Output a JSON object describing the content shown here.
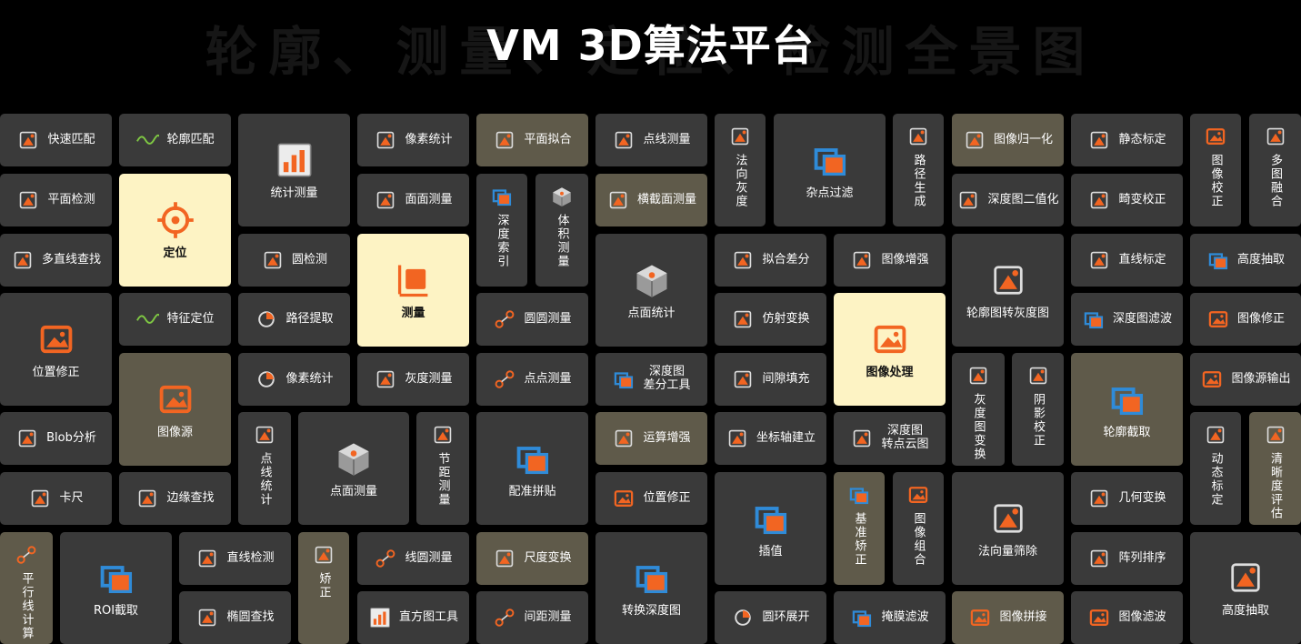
{
  "title": "VM 3D算法平台",
  "ghost_title": "轮廓、测量、定位、检测全景图",
  "colors": {
    "accent": "#f26522",
    "blue": "#2f8bd8",
    "tile": "#3a3a3a",
    "olive": "#5f5a4a",
    "highlight": "#fdf3c4"
  },
  "tiles": [
    {
      "label": "快速匹配",
      "icon": "cone-match-icon"
    },
    {
      "label": "轮廓匹配",
      "icon": "wave-icon"
    },
    {
      "label": "统计测量",
      "icon": "bar-chart-icon"
    },
    {
      "label": "像素统计",
      "icon": "pixel-grid-icon"
    },
    {
      "label": "平面拟合",
      "icon": "plane-fit-icon"
    },
    {
      "label": "点线测量",
      "icon": "point-line-icon"
    },
    {
      "label": "法向灰度",
      "icon": "normal-gray-icon"
    },
    {
      "label": "杂点过滤",
      "icon": "noise-filter-icon"
    },
    {
      "label": "路径生成",
      "icon": "path-icon"
    },
    {
      "label": "图像归一化",
      "icon": "normalize-icon"
    },
    {
      "label": "静态标定",
      "icon": "static-calib-icon"
    },
    {
      "label": "图像校正",
      "icon": "image-correct-icon"
    },
    {
      "label": "多图融合",
      "icon": "multi-image-icon"
    },
    {
      "label": "平面检测",
      "icon": "plane-detect-icon"
    },
    {
      "label": "定位",
      "icon": "crosshair-icon"
    },
    {
      "label": "面面测量",
      "icon": "face-face-icon"
    },
    {
      "label": "深度索引",
      "icon": "depth-index-icon"
    },
    {
      "label": "体积测量",
      "icon": "cube-icon"
    },
    {
      "label": "横截面测量",
      "icon": "cross-section-icon"
    },
    {
      "label": "深度图二值化",
      "icon": "binarize-icon"
    },
    {
      "label": "畸变校正",
      "icon": "distortion-icon"
    },
    {
      "label": "多直线查找",
      "icon": "multi-line-icon"
    },
    {
      "label": "圆检测",
      "icon": "circle-detect-icon"
    },
    {
      "label": "测量",
      "icon": "measure-icon"
    },
    {
      "label": "点面统计",
      "icon": "point-plane-stat-icon"
    },
    {
      "label": "拟合差分",
      "icon": "fit-diff-icon"
    },
    {
      "label": "图像增强",
      "icon": "enhance-icon"
    },
    {
      "label": "轮廓图转灰度图",
      "icon": "contour-gray-icon"
    },
    {
      "label": "直线标定",
      "icon": "line-calib-icon"
    },
    {
      "label": "高度抽取",
      "icon": "layers-icon"
    },
    {
      "label": "位置修正",
      "icon": "image-icon"
    },
    {
      "label": "特征定位",
      "icon": "wave-icon"
    },
    {
      "label": "路径提取",
      "icon": "hexagon-icon"
    },
    {
      "label": "圆圆测量",
      "icon": "two-circles-icon"
    },
    {
      "label": "仿射变换",
      "icon": "affine-icon"
    },
    {
      "label": "图像处理",
      "icon": "image-gear-icon"
    },
    {
      "label": "深度图滤波",
      "icon": "depth-filter-icon"
    },
    {
      "label": "图像修正",
      "icon": "image-fix-icon"
    },
    {
      "label": "图像源",
      "icon": "image-icon"
    },
    {
      "label": "像素统计",
      "icon": "pie-icon"
    },
    {
      "label": "灰度测量",
      "icon": "gray-measure-icon"
    },
    {
      "label": "点点测量",
      "icon": "point-point-icon"
    },
    {
      "label": "深度图\n差分工具",
      "icon": "depth-diff-icon"
    },
    {
      "label": "间隙填充",
      "icon": "gap-fill-icon"
    },
    {
      "label": "灰度图变换",
      "icon": "gray-transform-icon"
    },
    {
      "label": "阴影校正",
      "icon": "shadow-icon"
    },
    {
      "label": "轮廓截取",
      "icon": "contour-crop-icon"
    },
    {
      "label": "图像源输出",
      "icon": "image-out-icon"
    },
    {
      "label": "Blob分析",
      "icon": "blob-icon"
    },
    {
      "label": "点线统计",
      "icon": "point-line-stat-icon"
    },
    {
      "label": "点面测量",
      "icon": "point-plane-icon"
    },
    {
      "label": "节距测量",
      "icon": "pitch-icon"
    },
    {
      "label": "配准拼贴",
      "icon": "register-icon"
    },
    {
      "label": "运算增强",
      "icon": "compute-enhance-icon"
    },
    {
      "label": "坐标轴建立",
      "icon": "axis-icon"
    },
    {
      "label": "深度图\n转点云图",
      "icon": "point-cloud-icon"
    },
    {
      "label": "动态标定",
      "icon": "dynamic-calib-icon"
    },
    {
      "label": "清晰度评估",
      "icon": "sharpness-icon"
    },
    {
      "label": "卡尺",
      "icon": "caliper-icon"
    },
    {
      "label": "边缘查找",
      "icon": "edge-find-icon"
    },
    {
      "label": "位置修正",
      "icon": "position-fix-icon"
    },
    {
      "label": "插值",
      "icon": "interp-icon"
    },
    {
      "label": "基准矫正",
      "icon": "datum-icon"
    },
    {
      "label": "图像组合",
      "icon": "image-combine-icon"
    },
    {
      "label": "法向量筛除",
      "icon": "normal-vector-icon"
    },
    {
      "label": "几何变换",
      "icon": "geometry-icon"
    },
    {
      "label": "平行线计算",
      "icon": "parallel-icon"
    },
    {
      "label": "ROI截取",
      "icon": "roi-icon"
    },
    {
      "label": "直线检测",
      "icon": "line-detect-icon"
    },
    {
      "label": "矫正",
      "icon": "correct-icon"
    },
    {
      "label": "线圆测量",
      "icon": "line-circle-icon"
    },
    {
      "label": "尺度变换",
      "icon": "scale-icon"
    },
    {
      "label": "转换深度图",
      "icon": "depth-convert-icon"
    },
    {
      "label": "阵列排序",
      "icon": "array-sort-icon"
    },
    {
      "label": "高度抽取",
      "icon": "height-extract-icon"
    },
    {
      "label": "椭圆查找",
      "icon": "ellipse-icon"
    },
    {
      "label": "直方图工具",
      "icon": "histogram-icon"
    },
    {
      "label": "间距测量",
      "icon": "spacing-icon"
    },
    {
      "label": "圆环展开",
      "icon": "ring-unwrap-icon"
    },
    {
      "label": "掩膜滤波",
      "icon": "mask-filter-icon"
    },
    {
      "label": "图像拼接",
      "icon": "image-stitch-icon"
    },
    {
      "label": "图像滤波",
      "icon": "image-filter-icon"
    }
  ]
}
